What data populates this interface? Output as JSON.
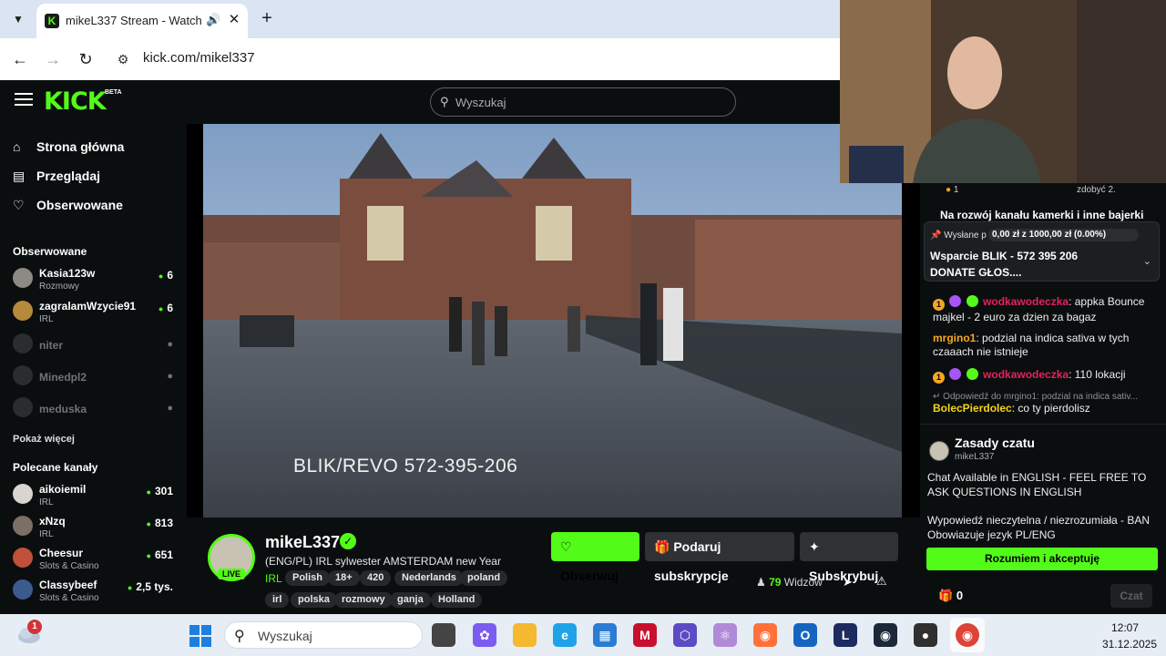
{
  "browser": {
    "tab_title": "mikeL337 Stream - Watch Li",
    "url": "kick.com/mikel337"
  },
  "header": {
    "logo": "KICK",
    "logo_badge": "BETA",
    "search_placeholder": "Wyszukaj"
  },
  "sidebar": {
    "nav": [
      {
        "label": "Strona główna",
        "icon": "home-icon"
      },
      {
        "label": "Przeglądaj",
        "icon": "browse-icon"
      },
      {
        "label": "Obserwowane",
        "icon": "heart-icon"
      }
    ],
    "followed_title": "Obserwowane",
    "followed": [
      {
        "name": "Kasia123w",
        "category": "Rozmowy",
        "viewers": "6"
      },
      {
        "name": "zagralamWzycie91",
        "category": "IRL",
        "viewers": "6"
      },
      {
        "name": "niter",
        "offline": true
      },
      {
        "name": "Minedpl2",
        "offline": true
      },
      {
        "name": "meduska",
        "offline": true
      }
    ],
    "show_more": "Pokaż więcej",
    "recommended_title": "Polecane kanały",
    "recommended": [
      {
        "name": "aikoiemil",
        "category": "IRL",
        "viewers": "301"
      },
      {
        "name": "xNzq",
        "category": "IRL",
        "viewers": "813"
      },
      {
        "name": "Cheesur",
        "category": "Slots & Casino",
        "viewers": "651"
      },
      {
        "name": "Classybeef",
        "category": "Slots & Casino",
        "viewers": "2,5 tys."
      }
    ]
  },
  "video": {
    "overlay_text": "BLIK/REVO  572-395-206"
  },
  "stream": {
    "live_label": "LIVE",
    "streamer": "mikeL337",
    "title": "(ENG/PL) IRL sylwester AMSTERDAM new Year",
    "category": "IRL",
    "tags_row1": [
      "Polish",
      "18+",
      "420",
      "Nederlands",
      "poland"
    ],
    "tags_row2": [
      "irl",
      "polska",
      "rozmowy",
      "ganja",
      "Holland"
    ],
    "follow_label": "Obserwuj",
    "gift_label": "Podaruj subskrypcje",
    "subscribe_label": "Subskrybuj",
    "viewers_count": "79",
    "viewers_label": "Widzów"
  },
  "chat": {
    "top_user_count": "1",
    "top_right_text": "zdobyć 2.",
    "banner_title": "Na rozwój kanału kamerki i inne bajerki",
    "pinned": {
      "prefix": "Wysłane p",
      "progress_text": "0,00 zł z 1000,00 zł (0.00%)",
      "progress_fraction": 0.0,
      "line1": "Wsparcie BLIK - 572 395 206",
      "line2": "DONATE GŁOS...."
    },
    "messages": [
      {
        "user": "wodkawodeczka",
        "text": "appka Bounce majkel - 2 euro za dzien za bagaz",
        "user_color": "#e0245e"
      },
      {
        "user": "mrgino1",
        "text": "podzial na indica sativa w tych czaaach nie istnieje",
        "user_color": "#f5a623"
      },
      {
        "user": "wodkawodeczka",
        "text": "110 lokacji",
        "user_color": "#e0245e"
      }
    ],
    "reply_ref": "Odpowiedź do mrgino1: podzial na indica sativ...",
    "last_message": {
      "user": "BolecPierdolec",
      "text": "co ty pierdolisz",
      "user_color": "#f5d31a"
    },
    "rules": {
      "title": "Zasady czatu",
      "owner": "mikeL337",
      "text1": "Chat Available in ENGLISH - FEEL FREE TO ASK QUESTIONS IN ENGLISH",
      "text2": "Wypowiedź nieczytelna / niezrozumiała - BAN Obowiazuje jezyk PL/ENG",
      "accept_label": "Rozumiem i akceptuję"
    },
    "gift_count": "0",
    "send_label": "Czat"
  },
  "taskbar": {
    "weather_badge": "1",
    "search_placeholder": "Wyszukaj",
    "time": "12:07",
    "date": "31.12.2025"
  },
  "colors": {
    "accent": "#53fc18",
    "background": "#0b0e0f"
  }
}
